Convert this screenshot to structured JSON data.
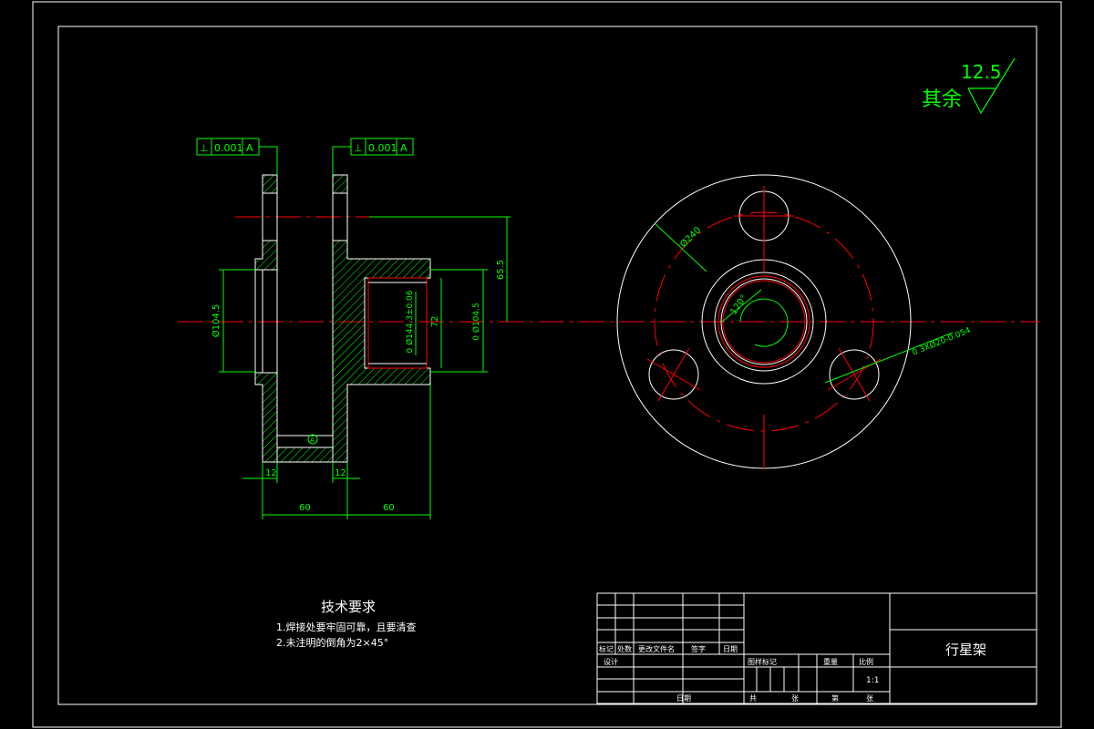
{
  "roughness": {
    "prefix": "其余",
    "value": "12.5"
  },
  "tolerance_left": {
    "symbol": "⊥",
    "value": "0.001",
    "datum": "A"
  },
  "tolerance_right": {
    "symbol": "⊥",
    "value": "0.001",
    "datum": "A"
  },
  "dims": {
    "dia_left": "Ø104.5",
    "dia_mid": "0 Ø144.3±0.06",
    "dim_72": "72",
    "dia_right": "0 Ø104.5",
    "dim_65": "65.5",
    "w12a": "12",
    "w12b": "12",
    "w60a": "60",
    "w60b": "60",
    "pcd": "Ø240",
    "angle": "120°",
    "hole": "0 3XØ20-0.054",
    "datum_a": "A"
  },
  "tech": {
    "title": "技术要求",
    "line1": "1.焊接处要牢固可靠，且要清查",
    "line2": "2.未注明的倒角为2×45°"
  },
  "title_block": {
    "part_name": "行星架",
    "scale": "1:1",
    "h_mark": "标记",
    "h_count": "处数",
    "h_doc": "更改文件名",
    "h_sign": "签字",
    "h_date": "日期",
    "design": "设计",
    "date2": "日期",
    "stage": "图样标记",
    "weight": "重量",
    "ratio": "比例",
    "sheets": "共",
    "sheet_unit": "张",
    "sheet_no": "第",
    "sheet_unit2": "张"
  }
}
